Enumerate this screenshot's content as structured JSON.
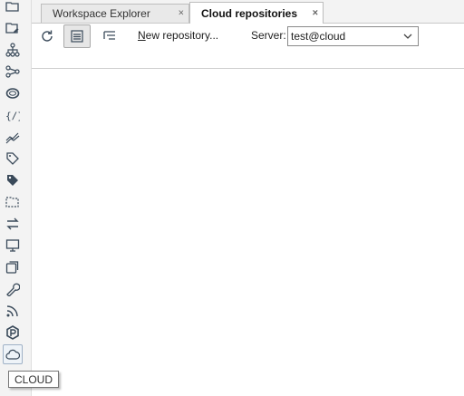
{
  "tabs": [
    {
      "label": "Workspace Explorer",
      "close": "×",
      "active": false
    },
    {
      "label": "Cloud repositories",
      "close": "×",
      "active": true
    }
  ],
  "toolbar": {
    "refresh_icon": "refresh-icon",
    "flat_view_icon": "flat-list-icon",
    "tree_view_icon": "tree-list-icon",
    "new_repository_mnemonic": "N",
    "new_repository_rest": "ew repository...",
    "server_label": "Server:",
    "server_value": "test@cloud"
  },
  "sidebar_icons": [
    "folder-icon",
    "folder-edit-icon",
    "hierarchy-icon",
    "connections-icon",
    "database-ring-icon",
    "code-braces-icon",
    "chart-line-icon",
    "tag-icon",
    "tags-icon",
    "folder-dashed-icon",
    "transfer-icon",
    "monitor-icon",
    "copy-icon",
    "wrench-icon",
    "rss-icon",
    "hex-logo-icon",
    "cloud-icon"
  ],
  "tooltip": "CLOUD",
  "colors": {
    "icon": "#3a4a5a",
    "active_border": "#9fb1c6"
  }
}
